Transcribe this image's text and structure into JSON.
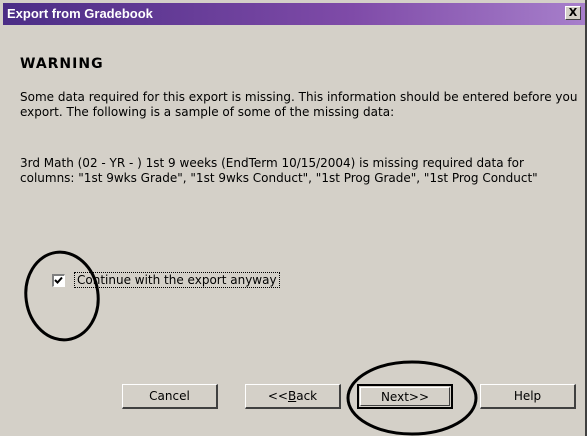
{
  "window": {
    "title": "Export from Gradebook",
    "close_glyph": "X"
  },
  "content": {
    "heading": "WARNING",
    "paragraph1": "Some data required for this export is missing. This information should be entered before you export.  The following is a sample of some of the missing data:",
    "paragraph2": "3rd Math (02 - YR - ) 1st 9 weeks (EndTerm 10/15/2004) is missing required data for columns: \"1st 9wks Grade\", \"1st 9wks Conduct\", \"1st Prog Grade\", \"1st Prog Conduct\""
  },
  "checkbox": {
    "label": "Continue with the export anyway",
    "checked": true
  },
  "buttons": {
    "cancel": "Cancel",
    "back_prefix": "<<",
    "back_mnemonic": "B",
    "back_rest": "ack",
    "next": "Next>>",
    "help": "Help"
  },
  "colors": {
    "titlebar_start": "#4b2d86",
    "titlebar_end": "#a77fcb",
    "face": "#d4d0c8"
  },
  "icons": {
    "close": "close-icon",
    "check": "checkmark-icon"
  }
}
